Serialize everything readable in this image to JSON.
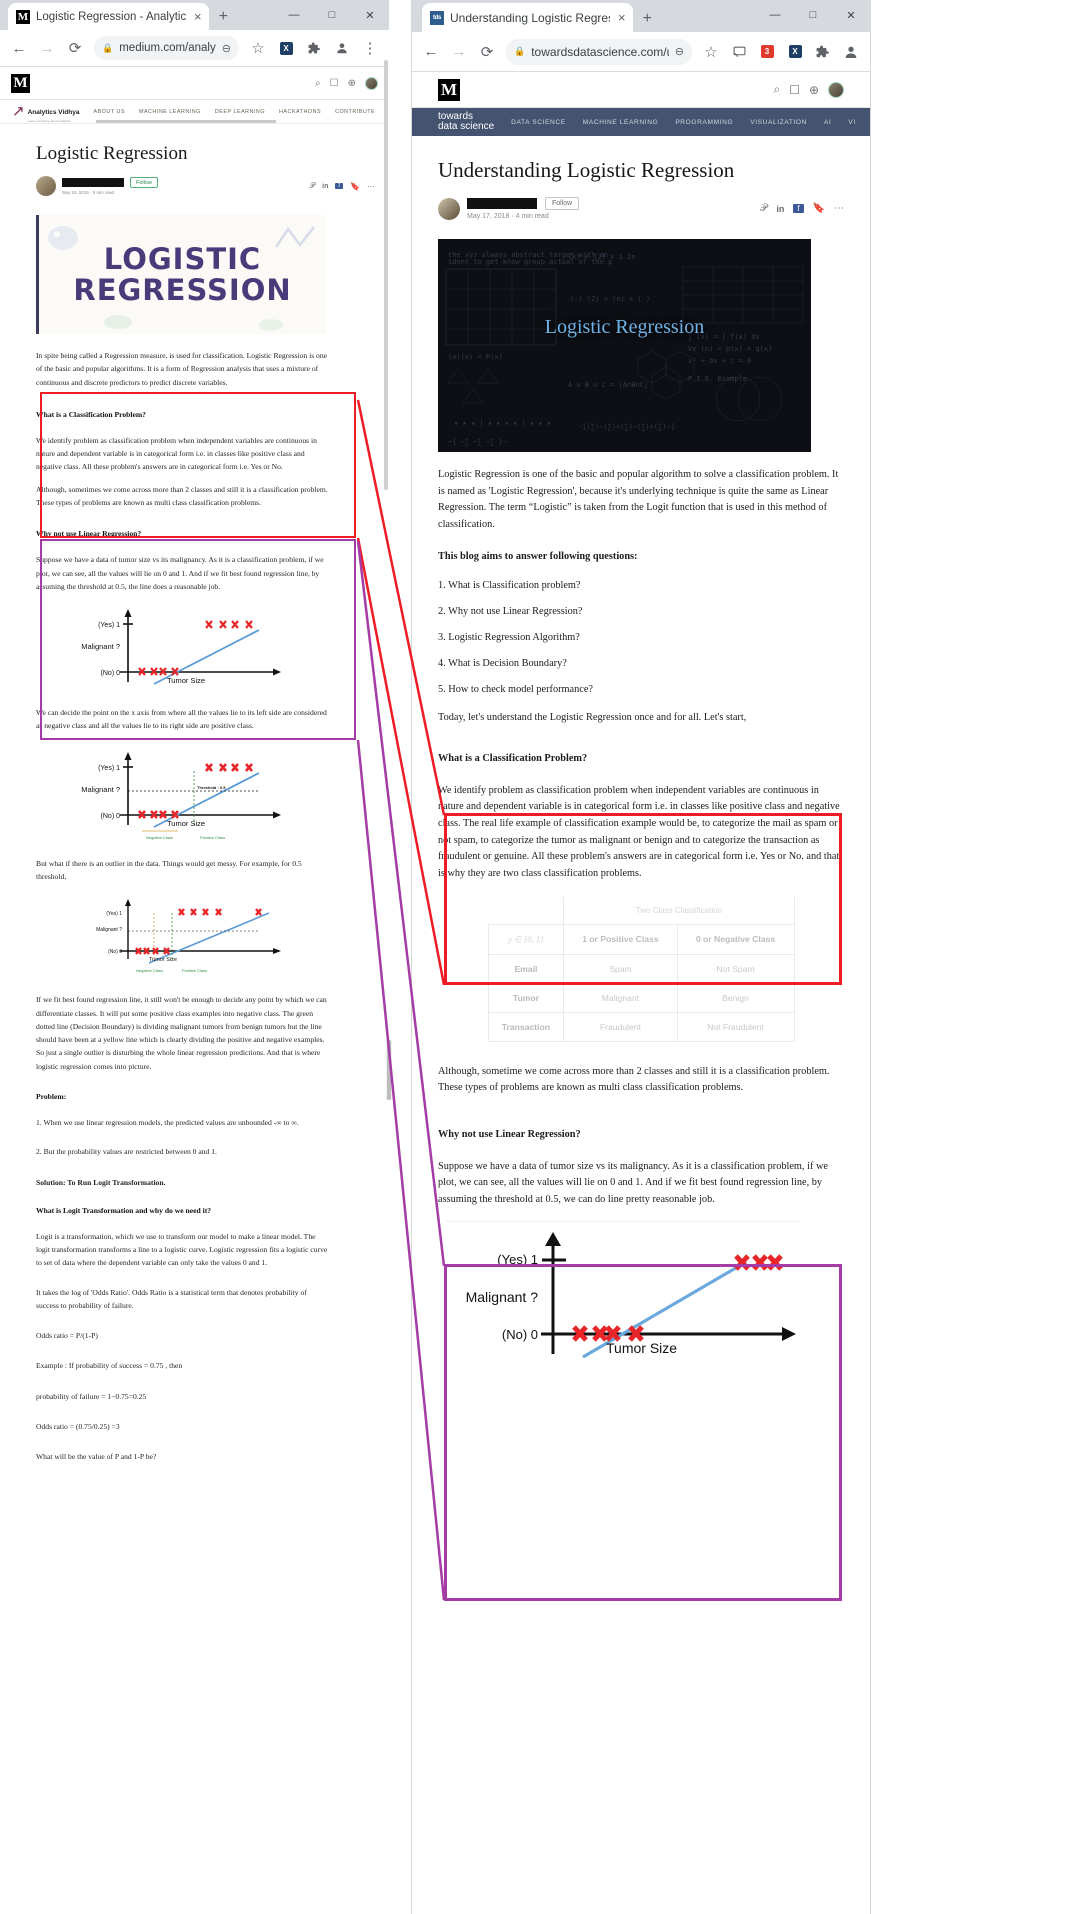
{
  "left_window": {
    "tab": {
      "title": "Logistic Regression - Analytics Vi",
      "favicon": "medium-m-icon",
      "close": "×"
    },
    "new_tab": "+",
    "window_controls": {
      "minimize": "—",
      "maximize": "□",
      "close": "✕"
    },
    "toolbar": {
      "back": "←",
      "forward": "→",
      "reload": "⟳",
      "lock": "🔒",
      "url": "medium.com/analytic...",
      "zoom_out": "⊖",
      "bookmark": "☆",
      "ext1": "X",
      "ext2": "puzzle-piece",
      "profile": "person",
      "menu": "⋮"
    },
    "medium_header": {
      "logo": "M",
      "search": "⌕",
      "bookmarks": "☐",
      "notifications": "⊕"
    },
    "publication_nav": {
      "logo_text": "Analytics Vidhya",
      "logo_tagline": "Learn everything about analytics",
      "items": [
        "ABOUT US",
        "MACHINE LEARNING",
        "DEEP LEARNING",
        "HACKATHONS",
        "CONTRIBUTE"
      ]
    },
    "article": {
      "title": "Logistic Regression",
      "author_redacted": true,
      "follow_label": "Follow",
      "meta": "Sep 10, 2019 · 5 min read",
      "hero_line1": "LOGISTIC",
      "hero_line2": "REGRESSION",
      "intro": "In spite being called a Regression measure, is used for classification. Logistic Regression is one of the basic and popular algorithms. It is a form of Regression analysis that uses a mixture of continuous and discrete predictors to predict discrete variables.",
      "section1_heading": "What is a Classification Problem?",
      "section1_p1": "We identify problem as classification problem when independent variables are continuous in nature and dependent variable is in categorical form i.e. in classes like positive class and negative class. All these problem's answers are in categorical form i.e. Yes or No.",
      "section1_p2": "Although, sometimes we come across more than 2 classes and still it is a classification problem. These types of problems are known as multi class classification problems.",
      "section2_heading": "Why not use Linear Regression?",
      "section2_p1": "Suppose we have a data of tumor size vs its malignancy. As it is a classification problem, if we plot, we can see, all the values will lie on 0 and 1. And if we fit best found regression line, by assuming the threshold at 0.5, the line does a reasonable job.",
      "after_chart1": "We can decide the point on the x axis from where all the values lie to its left side are considered as negative class and all the values lie to its right side are positive class.",
      "after_chart2": "But what if there is an outlier in the data. Things would get messy. For example, for 0.5 threshold,",
      "after_chart3": "If we fit best found regression line, it still won't be enough to decide any point by which we can differentiate classes. It will put some positive class examples into negative class. The green dotted line (Decision Boundary) is dividing malignant tumors from benign tumors but the line should have been at a yellow line which is clearly dividing the positive and negative examples. So just a single outlier is disturbing the whole linear regression predictions. And that is where logistic regression comes into picture.",
      "problem_heading": "Problem:",
      "problem_1": "1. When we use linear regression models, the predicted values are unbounded -∞ to ∞.",
      "problem_2": "2. But the probability values are restricted between 0 and 1.",
      "solution": "Solution: To Run Logit Transformation.",
      "logit_heading": "What is Logit Transformation and why do we need it?",
      "logit_p1": "Logit is a transformation, which we use to transform our model to make a linear model. The logit transformation transforms a line to a logistic curve. Logistic regression fits a logistic curve to set of data where the dependent variable can only take the values 0 and 1.",
      "logit_p2": "It takes the log of 'Odds Ratio'. Odds Ratio is a statistical term that denotes probability of success to probability of failure.",
      "odds_1": "Odds ratio = P/(1-P)",
      "odds_2": "Example : If probability of success = 0.75 , then",
      "odds_3": "probability of failure = 1−0.75=0.25",
      "odds_4": "Odds ratio = (0.75/0.25) =3",
      "odds_5": "What will be the value of P and 1-P be?"
    },
    "charts": [
      {
        "name": "tumor-size-chart-1",
        "y_top": "(Yes) 1",
        "y_mid": "Malignant ?",
        "y_bottom": "(No) 0",
        "x_label": "Tumor Size"
      },
      {
        "name": "tumor-size-chart-2",
        "y_top": "(Yes) 1",
        "y_mid": "Malignant ?",
        "y_bottom": "(No) 0",
        "x_label": "Tumor Size",
        "threshold": "Threshold : 0.5",
        "neg_label": "Negative Class",
        "pos_label": "Positive Class"
      },
      {
        "name": "tumor-size-chart-3",
        "y_top": "(Yes) 1",
        "y_mid": "Malignant ?",
        "y_bottom": "(No) 0",
        "x_label": "Tumor Size",
        "neg_label": "Negative Class",
        "pos_label": "Positive Class"
      }
    ]
  },
  "right_window": {
    "tab": {
      "title": "Understanding Logistic Regressio",
      "favicon": "tds",
      "close": "×"
    },
    "new_tab": "+",
    "window_controls": {
      "minimize": "—",
      "maximize": "□",
      "close": "✕"
    },
    "toolbar": {
      "back": "←",
      "forward": "→",
      "reload": "⟳",
      "lock": "🔒",
      "url": "towardsdatascience.com/u...",
      "zoom_out": "⊖",
      "bookmark": "☆",
      "ext1": "cast",
      "ext2": "3",
      "ext3": "X",
      "ext4": "puzzle-piece",
      "profile": "person"
    },
    "medium_header": {
      "logo": "M",
      "search": "⌕",
      "bookmarks": "☐",
      "notifications": "⊕"
    },
    "tds_nav": {
      "brand_line1": "towards",
      "brand_line2": "data science",
      "items": [
        "DATA SCIENCE",
        "MACHINE LEARNING",
        "PROGRAMMING",
        "VISUALIZATION",
        "AI",
        "VI"
      ]
    },
    "article": {
      "title": "Understanding Logistic Regression",
      "follow_label": "Follow",
      "meta": "May 17, 2018 · 4 min read",
      "hero_title": "Logistic Regression",
      "intro": "Logistic Regression is one of the basic and popular algorithm to solve a classification problem. It is named as 'Logistic Regression', because it's underlying technique is quite the same as Linear Regression. The term “Logistic” is taken from the Logit function that is used in this method of classification.",
      "intro_bold": "Logit function",
      "questions_heading": "This blog aims to answer following questions:",
      "questions": [
        "1. What is Classification problem?",
        "2. Why not use Linear Regression?",
        "3. Logistic Regression Algorithm?",
        "4. What is Decision Boundary?",
        "5. How to check model performance?"
      ],
      "today_line": "Today, let's understand the Logistic Regression once and for all. Let's start,",
      "section1_heading": "What is a Classification Problem?",
      "section1_p1": "We identify problem as classification problem when independent variables are continuous in nature and dependent variable is in categorical form i.e. in classes like positive class and negative class. The real life example of classification example would be, to categorize the mail as spam or not spam, to categorize the tumor as malignant or benign and to categorize the transaction as fraudulent or genuine. All these problem's answers are in categorical form i.e. Yes or No. and that is why they are two class classification problems.",
      "after_table": "Although, sometime we come across more than 2 classes and still it is a classification problem. These types of problems are known as multi class classification problems.",
      "section2_heading": "Why not use Linear Regression?",
      "section2_p1": "Suppose we have a data of tumor size vs its malignancy. As it is a classification problem, if we plot, we can see, all the values will lie on 0 and 1. And if we fit best found regression line, by assuming the threshold at 0.5, we can do line pretty reasonable job.",
      "section2_bold_0": "0",
      "section2_bold_1": "1"
    },
    "table": {
      "caption": "Two Class Classification",
      "corner": "y ∈ {0, 1}",
      "col1": "1 or Positive Class",
      "col2": "0 or Negative Class",
      "rows": [
        {
          "label": "Email",
          "positive": "Spam",
          "negative": "Not Spam"
        },
        {
          "label": "Tumor",
          "positive": "Malignant",
          "negative": "Benign"
        },
        {
          "label": "Transaction",
          "positive": "Fraudulent",
          "negative": "Not Fraudulent"
        }
      ]
    },
    "chart": {
      "name": "tumor-size-chart",
      "y_top": "(Yes) 1",
      "y_mid": "Malignant ?",
      "y_bottom": "(No) 0",
      "x_label": "Tumor Size"
    }
  },
  "annotations": {
    "red_highlight_color": "#ee1c25",
    "purple_highlight_color": "#a53ba5"
  }
}
